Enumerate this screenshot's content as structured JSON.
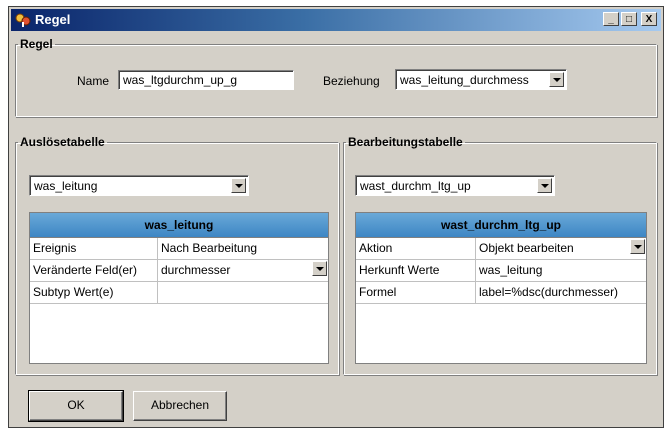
{
  "window": {
    "title": "Regel",
    "minimize": "_",
    "maximize": "□",
    "close": "X"
  },
  "regel": {
    "legend": "Regel",
    "name_label": "Name",
    "name_value": "was_ltgdurchm_up_g",
    "beziehung_label": "Beziehung",
    "beziehung_value": "was_leitung_durchmess"
  },
  "left": {
    "legend": "Auslösetabelle",
    "combo_value": "was_leitung",
    "table_title": "was_leitung",
    "rows": [
      {
        "key": "Ereignis",
        "value": "Nach Bearbeitung"
      },
      {
        "key": "Veränderte Feld(er)",
        "value": "durchmesser"
      },
      {
        "key": "Subtyp Wert(e)",
        "value": ""
      }
    ]
  },
  "right": {
    "legend": "Bearbeitungstabelle",
    "combo_value": "wast_durchm_ltg_up",
    "table_title": "wast_durchm_ltg_up",
    "rows": [
      {
        "key": "Aktion",
        "value": "Objekt bearbeiten"
      },
      {
        "key": "Herkunft Werte",
        "value": "was_leitung"
      },
      {
        "key": "Formel",
        "value": "label=%dsc(durchmesser)"
      }
    ]
  },
  "buttons": {
    "ok": "OK",
    "cancel": "Abbrechen"
  },
  "colors": {
    "title_start": "#0a246a",
    "title_end": "#a6caf0",
    "table_header": "#4a90cc",
    "face": "#d4d0c8"
  }
}
